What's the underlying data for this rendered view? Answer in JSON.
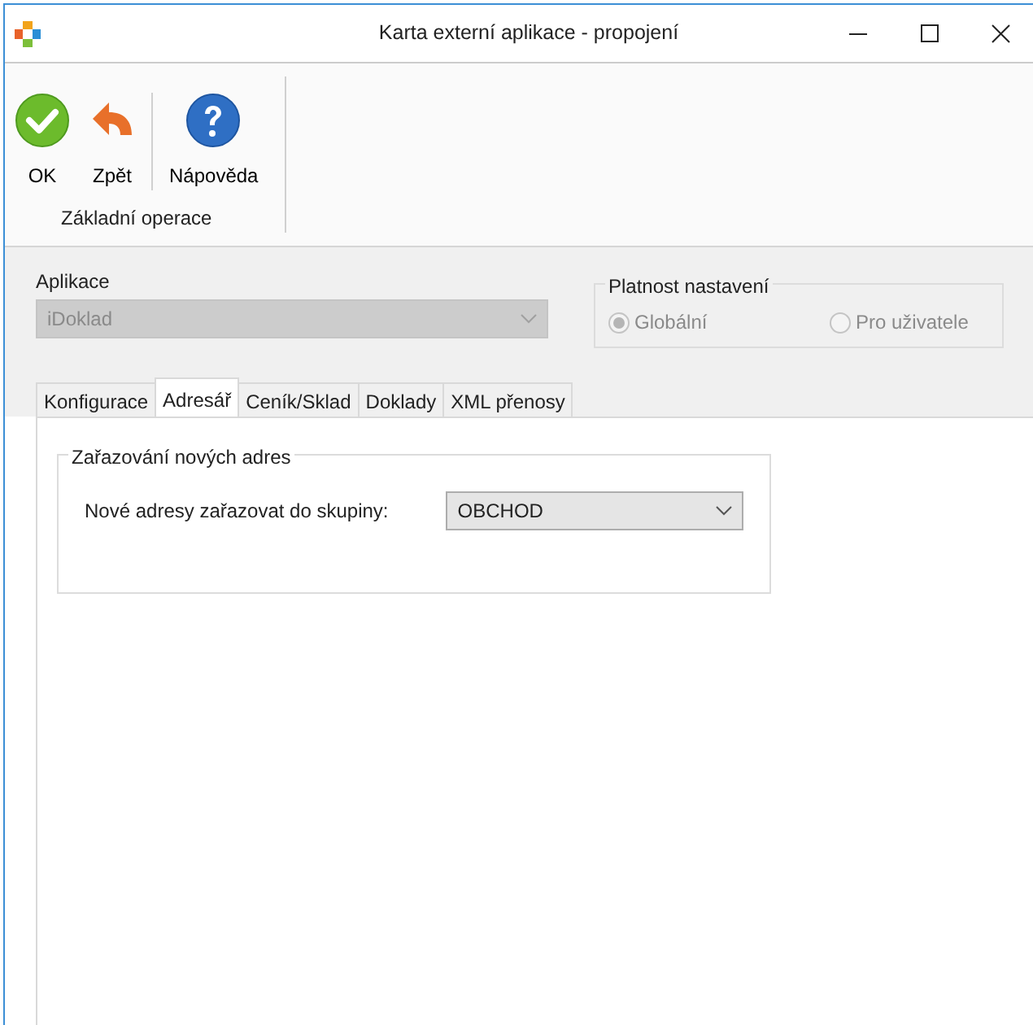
{
  "window": {
    "title": "Karta externí aplikace - propojení",
    "controls": [
      {
        "kind": "minimize"
      },
      {
        "kind": "maximize"
      },
      {
        "kind": "close"
      }
    ]
  },
  "toolbar": {
    "buttons": [
      {
        "label": "OK",
        "kind": "ok"
      },
      {
        "label": "Zpět",
        "kind": "back"
      },
      {
        "label": "Nápověda",
        "kind": "help"
      }
    ],
    "group_label": "Základní operace"
  },
  "application": {
    "label": "Aplikace",
    "value": "iDoklad",
    "disabled": true
  },
  "validity": {
    "legend": "Platnost nastavení",
    "disabled": true,
    "options": [
      {
        "label": "Globální",
        "selected": true
      },
      {
        "label": "Pro uživatele",
        "selected": false
      }
    ]
  },
  "tabs": [
    {
      "label": "Konfigurace",
      "selected": false
    },
    {
      "label": "Adresář",
      "selected": true
    },
    {
      "label": "Ceník/Sklad",
      "selected": false
    },
    {
      "label": "Doklady",
      "selected": false
    },
    {
      "label": "XML přenosy",
      "selected": false
    }
  ],
  "group": {
    "legend": "Zařazování nových adres",
    "field_label": "Nové adresy zařazovat do skupiny:",
    "value": "OBCHOD"
  }
}
